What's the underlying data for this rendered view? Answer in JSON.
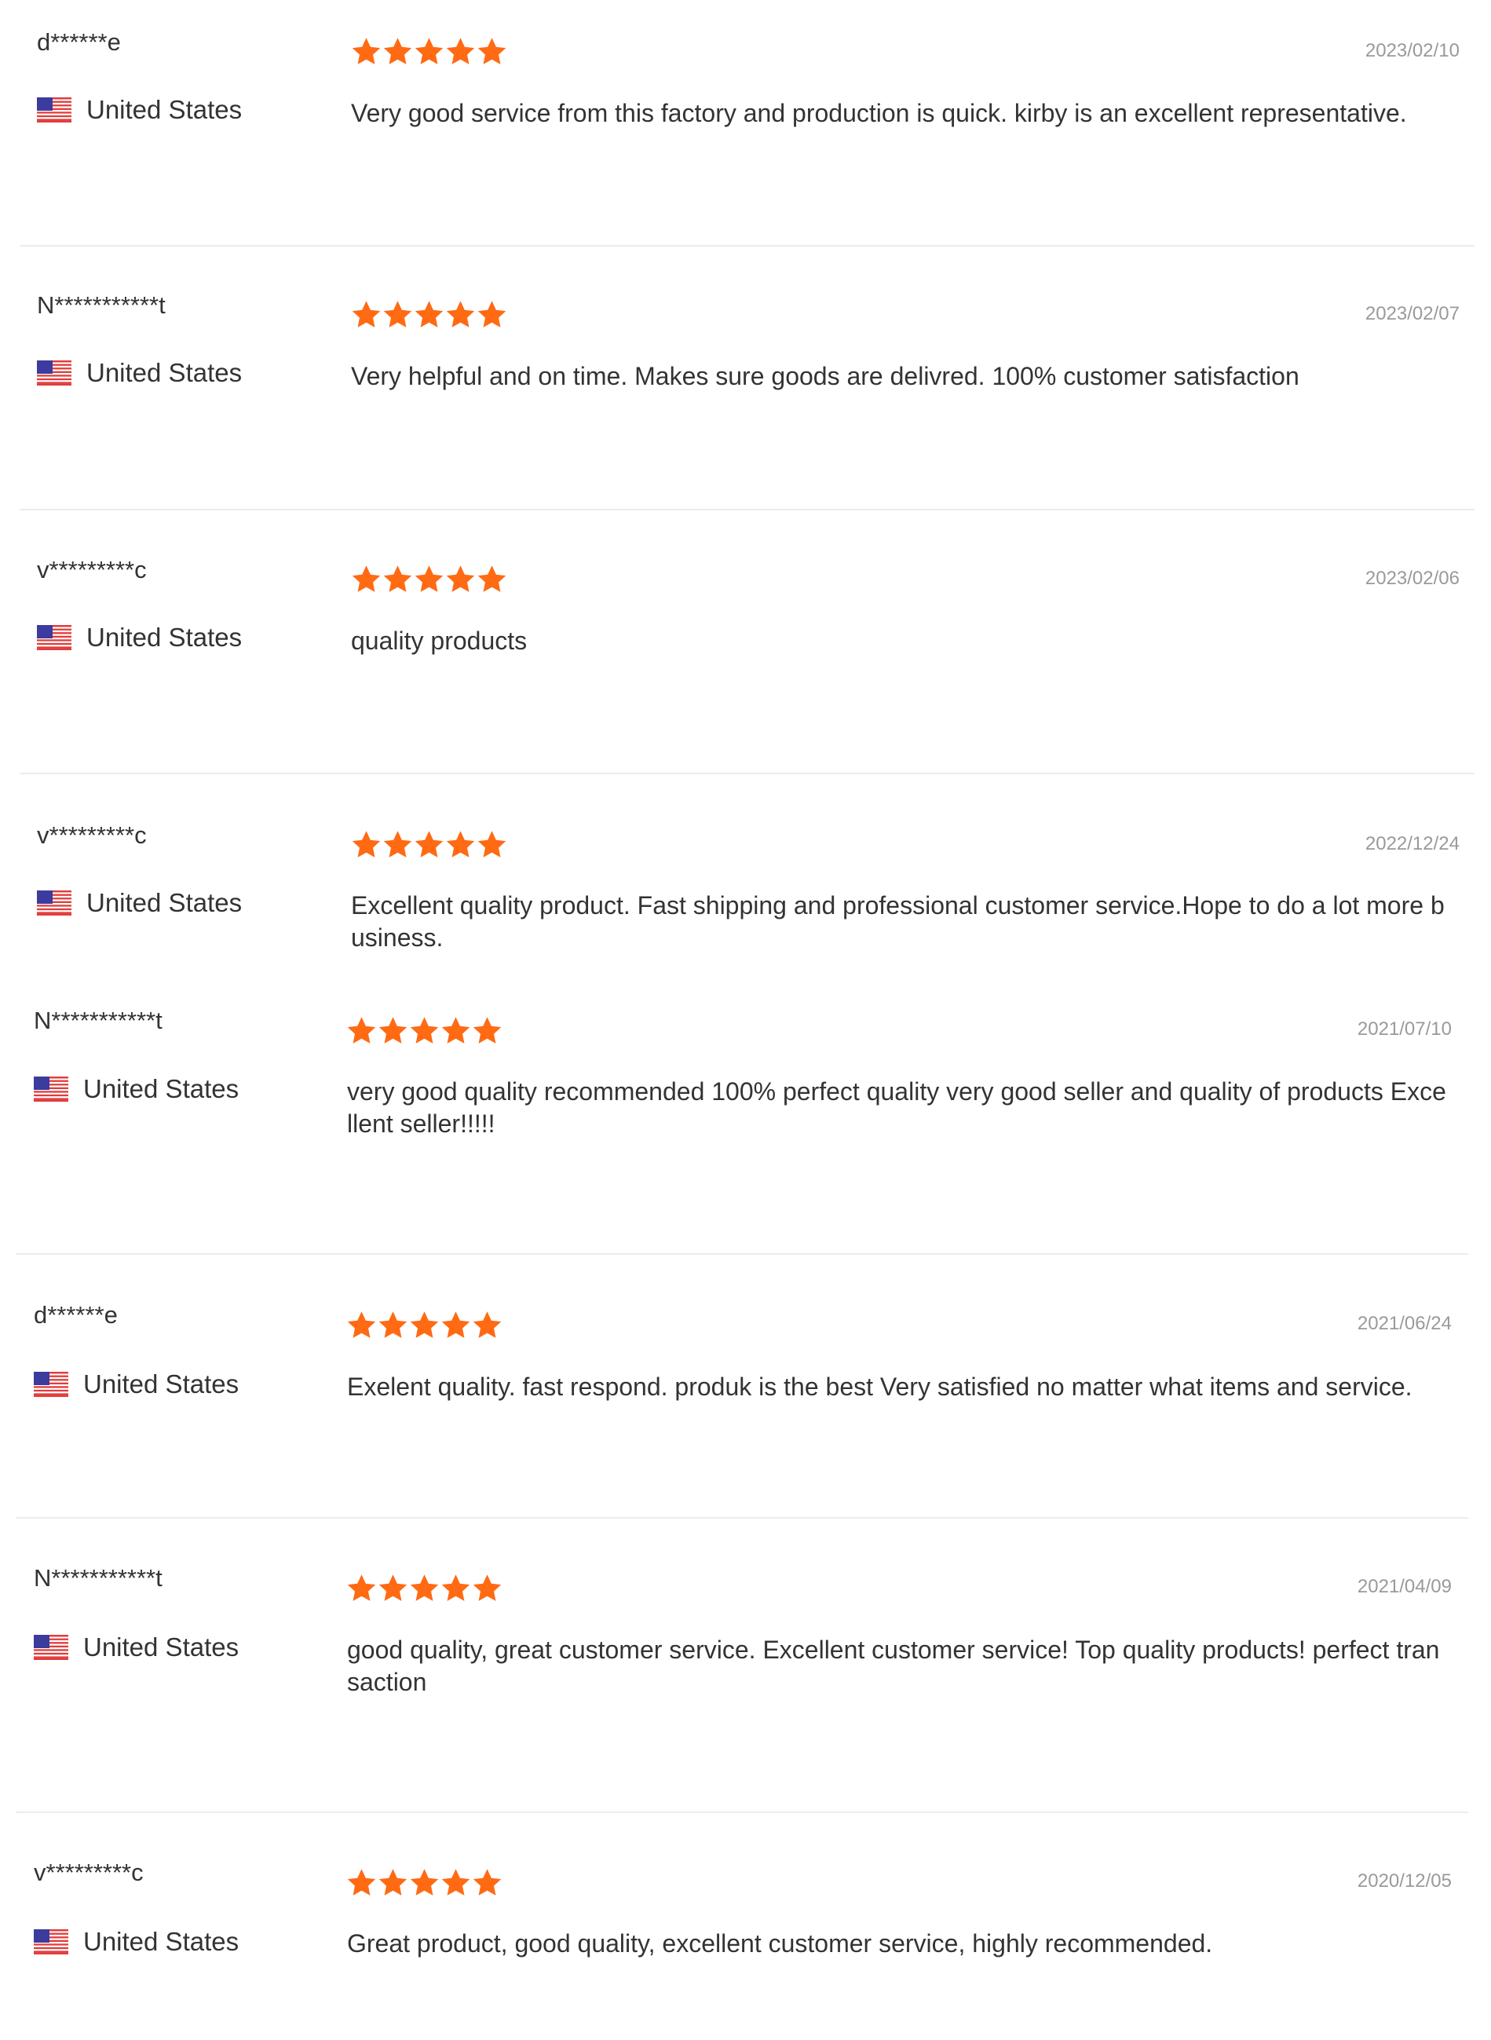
{
  "colors": {
    "star": "#ff6a13",
    "divider": "#ececec",
    "date": "#9a9a9a",
    "text": "#333333"
  },
  "icons": {
    "rating": "star-icon",
    "country_flag": "us-flag-icon"
  },
  "reviews": [
    {
      "reviewer": "d******e",
      "country": "United States",
      "rating": 5,
      "date": "2023/02/10",
      "text": "Very good service from this factory and production is quick. kirby is an excellent representative."
    },
    {
      "reviewer": "N***********t",
      "country": "United States",
      "rating": 5,
      "date": "2023/02/07",
      "text": "Very helpful and on time. Makes sure goods are delivred. 100% customer satisfaction"
    },
    {
      "reviewer": "v*********c",
      "country": "United States",
      "rating": 5,
      "date": "2023/02/06",
      "text": "quality products"
    },
    {
      "reviewer": "v*********c",
      "country": "United States",
      "rating": 5,
      "date": "2022/12/24",
      "text": "Excellent quality product. Fast shipping and professional customer service.Hope to do a lot more business."
    },
    {
      "reviewer": "N***********t",
      "country": "United States",
      "rating": 5,
      "date": "2021/07/10",
      "text": "very good quality recommended 100% perfect quality very good seller and quality of products Excellent seller!!!!!"
    },
    {
      "reviewer": "d******e",
      "country": "United States",
      "rating": 5,
      "date": "2021/06/24",
      "text": "Exelent quality. fast respond. produk is the best Very satisfied no matter what items and service."
    },
    {
      "reviewer": "N***********t",
      "country": "United States",
      "rating": 5,
      "date": "2021/04/09",
      "text": "good quality, great customer service. Excellent customer service! Top quality products! perfect transaction"
    },
    {
      "reviewer": "v*********c",
      "country": "United States",
      "rating": 5,
      "date": "2020/12/05",
      "text": "Great product, good quality, excellent customer service, highly recommended."
    }
  ]
}
